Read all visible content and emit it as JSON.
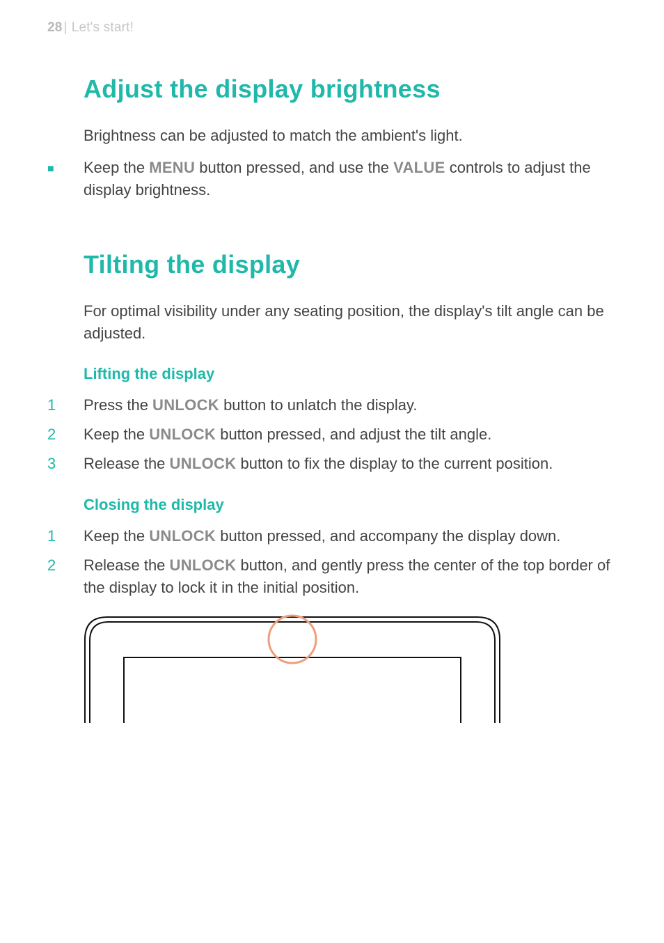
{
  "page_number": "28",
  "header_pipe": "|",
  "chapter_title": "Let's start!",
  "sections": {
    "brightness": {
      "title": "Adjust the display brightness",
      "intro": "Brightness can be adjusted to match the ambient's light.",
      "bullet1_pre": "Keep the ",
      "bullet1_kw1": "MENU",
      "bullet1_mid": " button pressed, and use the ",
      "bullet1_kw2": "VALUE",
      "bullet1_post": " controls to adjust the display brightness."
    },
    "tilting": {
      "title": "Tilting the display",
      "intro": "For optimal visibility under any seating position, the display's tilt angle can be adjusted.",
      "lifting_title": "Lifting the display",
      "lift1_pre": "Press the ",
      "lift1_kw": "UNLOCK",
      "lift1_post": " button to unlatch the display.",
      "lift2_pre": "Keep the ",
      "lift2_kw": "UNLOCK",
      "lift2_post": " button pressed, and adjust the tilt angle.",
      "lift3_pre": "Release the ",
      "lift3_kw": "UNLOCK",
      "lift3_post": " button to fix the display to the current position.",
      "closing_title": "Closing the display",
      "close1_pre": "Keep the ",
      "close1_kw": "UNLOCK",
      "close1_post": " button pressed, and accompany the display down.",
      "close2_pre": "Release the ",
      "close2_kw": "UNLOCK",
      "close2_post": " button, and gently press the center of the top border of the display to lock it in the initial position."
    }
  },
  "nums": {
    "n1": "1",
    "n2": "2",
    "n3": "3"
  },
  "bullet_glyph": "■"
}
